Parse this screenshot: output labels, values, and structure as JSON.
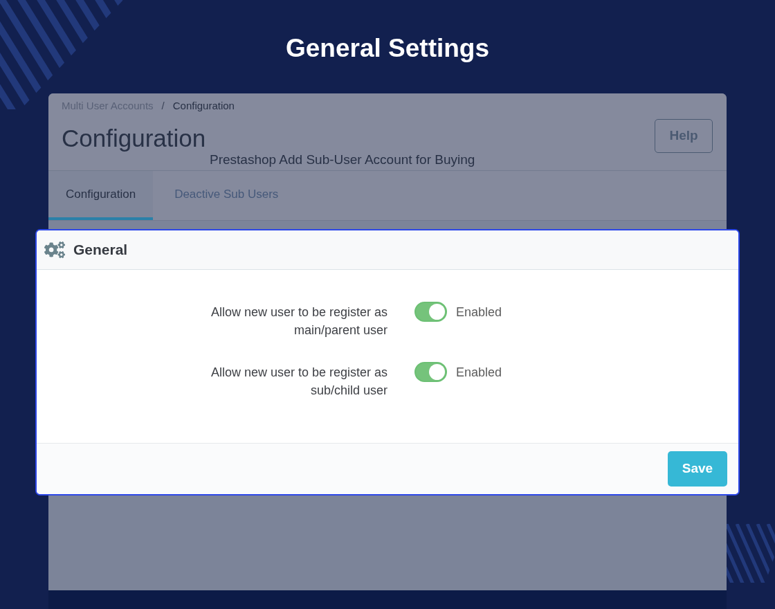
{
  "banner": {
    "title": "General Settings"
  },
  "page": {
    "breadcrumb": [
      {
        "label": "Multi User Accounts",
        "current": false
      },
      {
        "label": "Configuration",
        "current": true
      }
    ],
    "separator": "/",
    "title": "Configuration",
    "subtitle": "Prestashop Add Sub-User Account for Buying",
    "help_button": "Help",
    "tabs": [
      {
        "label": "Configuration",
        "selected": true
      },
      {
        "label": "Deactive Sub Users",
        "selected": false
      }
    ]
  },
  "panel": {
    "title": "General",
    "settings": [
      {
        "label": "Allow new user to be register as main/parent user",
        "on": true,
        "status": "Enabled"
      },
      {
        "label": "Allow new user to be register as sub/child user",
        "on": true,
        "status": "Enabled"
      }
    ],
    "save_button": "Save"
  }
}
